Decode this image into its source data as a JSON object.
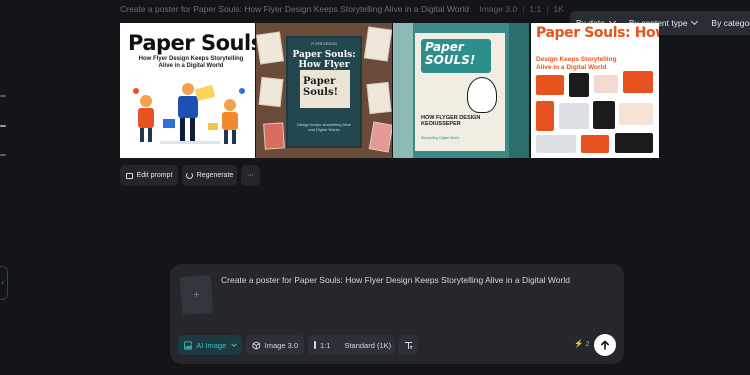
{
  "header": {
    "prompt": "Create a poster for Paper Souls: How Flyer Design Keeps Storytelling Alive in a Digital World",
    "model": "Image 3.0",
    "ratio": "1:1",
    "resolution": "1K"
  },
  "filters": {
    "by_date": "By date",
    "by_content_type": "By content type",
    "by_category": "By category"
  },
  "sidebar": {
    "collapse_glyph": "‹"
  },
  "tiles": {
    "t1": {
      "title": "Paper Souls:",
      "subtitle": "How Flyer Design Keeps Storytelling Alive in a Digital World"
    },
    "t2": {
      "top": "FLYER DESIGN",
      "title": "Paper Souls: How Flyer Design",
      "inner": "Paper Souls!",
      "body": "Design keeps storytelling Alive and Digital Works"
    },
    "t3": {
      "title": "Paper SOULS!",
      "bottom": "HOW FLYGER DESIGN KEOIUSSEPER",
      "small": "Storytelling Digital World"
    },
    "t4": {
      "title": "Paper Souls: How Flyer",
      "title2": "Design Keeps Storytelling",
      "title3": "Alive in a Digital World"
    }
  },
  "actions": {
    "edit_prompt": "Edit prompt",
    "regenerate": "Regenerate",
    "more": "···"
  },
  "composer": {
    "prompt_text": "Create a poster for Paper Souls: How Flyer Design Keeps Storytelling Alive in a Digital World",
    "attach_glyph": "+",
    "ai_image": "AI Image",
    "model": "Image 3.0",
    "ratio": "1:1",
    "quality": "Standard (1K)",
    "credits": "2",
    "credit_icon": "lightning-icon"
  },
  "colors": {
    "background": "#141519",
    "accent_teal": "#2ec6c8",
    "orange": "#e8521f"
  }
}
